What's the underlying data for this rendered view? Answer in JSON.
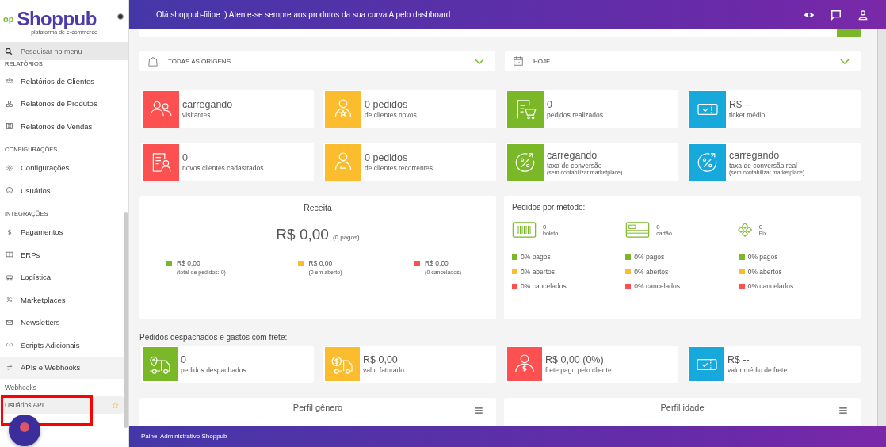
{
  "sidebar": {
    "brand": "Shoppub",
    "brand_mark": "op",
    "tagline": "plataforma de e-commerce",
    "search": {
      "placeholder": "Pesquisar no menu"
    },
    "sections": [
      {
        "title": "RELATÓRIOS",
        "items": [
          {
            "label": "Relatórios de Clientes"
          },
          {
            "label": "Relatórios de Produtos"
          },
          {
            "label": "Relatórios de Vendas"
          }
        ]
      },
      {
        "title": "CONFIGURAÇÕES",
        "items": [
          {
            "label": "Configurações"
          },
          {
            "label": "Usuários"
          }
        ]
      },
      {
        "title": "INTEGRAÇÕES",
        "items": [
          {
            "label": "Pagamentos"
          },
          {
            "label": "ERPs"
          },
          {
            "label": "Logística"
          },
          {
            "label": "Marketplaces"
          },
          {
            "label": "Newsletters"
          },
          {
            "label": "Scripts Adicionais"
          },
          {
            "label": "APIs e Webhooks",
            "expanded": true,
            "children": [
              {
                "label": "Webhooks",
                "selected": false
              },
              {
                "label": "Usuários API",
                "selected": true
              }
            ]
          }
        ]
      }
    ]
  },
  "header": {
    "greeting": "Olá shoppub-filipe :) Atente-se sempre aos produtos da sua curva A pelo dashboard"
  },
  "filters": [
    {
      "label": "TODAS AS ORIGENS"
    },
    {
      "label": "HOJE"
    }
  ],
  "stats": [
    {
      "value": "carregando",
      "label": "visitantes",
      "color": "#fd5151"
    },
    {
      "value": "0 pedidos",
      "label": "de clientes novos",
      "color": "#fbbc2d"
    },
    {
      "value": "0",
      "label": "pedidos realizados",
      "color": "#7ab827"
    },
    {
      "value": "R$ --",
      "label": "ticket médio",
      "color": "#17a9dc"
    },
    {
      "value": "0",
      "label": "novos clientes cadastrados",
      "color": "#fd5151"
    },
    {
      "value": "0 pedidos",
      "label": "de clientes recorrentes",
      "color": "#fbbc2d"
    },
    {
      "value": "carregando",
      "label": "taxa de conversão",
      "note": "(sem contabilizar marketplace)",
      "color": "#7ab827"
    },
    {
      "value": "carregando",
      "label": "taxa de conversão real",
      "note": "(sem contabilizar marketplace)",
      "color": "#17a9dc"
    }
  ],
  "revenue": {
    "title": "Receita",
    "amount": "R$ 0,00",
    "amount_note": "(0 pagos)",
    "legend": [
      {
        "value": "R$ 0,00",
        "note": "(total de pedidos: 0)",
        "color": "#7ab827"
      },
      {
        "value": "R$ 0,00",
        "note": "(0 em aberto)",
        "color": "#fbbc2d"
      },
      {
        "value": "R$ 0,00",
        "note": "(0 cancelados)",
        "color": "#fd5151"
      }
    ]
  },
  "methods": {
    "title": "Pedidos por método:",
    "items": [
      {
        "count": "0",
        "label": "boleto",
        "stats": [
          {
            "text": "0% pagos",
            "color": "#7ab827"
          },
          {
            "text": "0% abertos",
            "color": "#fbbc2d"
          },
          {
            "text": "0% cancelados",
            "color": "#fd5151"
          }
        ]
      },
      {
        "count": "0",
        "label": "cartão",
        "stats": [
          {
            "text": "0% pagos",
            "color": "#7ab827"
          },
          {
            "text": "0% abertos",
            "color": "#fbbc2d"
          },
          {
            "text": "0% cancelados",
            "color": "#fd5151"
          }
        ]
      },
      {
        "count": "0",
        "label": "Pix",
        "stats": [
          {
            "text": "0% pagos",
            "color": "#7ab827"
          },
          {
            "text": "0% abertos",
            "color": "#fbbc2d"
          },
          {
            "text": "0% cancelados",
            "color": "#fd5151"
          }
        ]
      }
    ]
  },
  "shipping": {
    "title": "Pedidos despachados e gastos com frete:",
    "cards": [
      {
        "value": "0",
        "label": "pedidos despachados",
        "color": "#7ab827"
      },
      {
        "value": "R$ 0,00",
        "label": "valor faturado",
        "color": "#fbbc2d"
      },
      {
        "value": "R$ 0,00 (0%)",
        "label": "frete pago pelo cliente",
        "color": "#fd5151"
      },
      {
        "value": "R$ --",
        "label": "valor médio de frete",
        "color": "#17a9dc"
      }
    ]
  },
  "profiles": [
    {
      "title": "Perfil gênero"
    },
    {
      "title": "Perfil idade"
    }
  ],
  "footer": {
    "text": "Painel Administrativo Shoppub"
  }
}
